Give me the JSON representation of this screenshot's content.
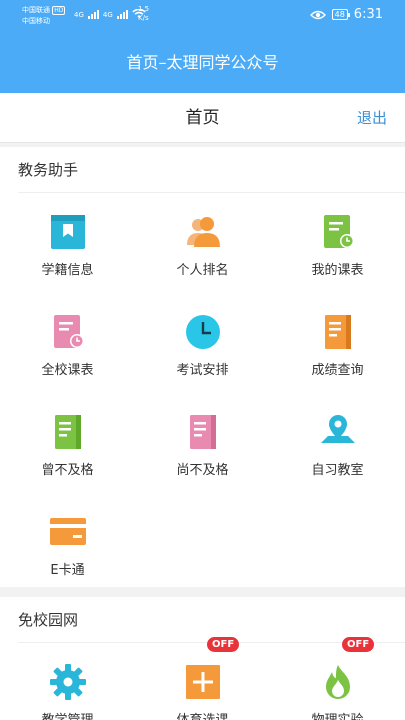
{
  "status_bar": {
    "carrier1": "中国联通",
    "carrier1_badge": "HD",
    "carrier2": "中国移动",
    "net1": "4G",
    "net2": "4G",
    "speed_value": "1.5",
    "speed_unit": "K/s",
    "battery": "48",
    "time": "6:31"
  },
  "app_bar": {
    "title": "首页–太理同学公众号"
  },
  "nav": {
    "title": "首页",
    "logout": "退出"
  },
  "sections": {
    "academic": {
      "title": "教务助手",
      "items": [
        {
          "label": "学籍信息",
          "icon": "bookmark-book-icon",
          "color": "#29b6d8"
        },
        {
          "label": "个人排名",
          "icon": "users-icon",
          "color": "#f59a3a"
        },
        {
          "label": "我的课表",
          "icon": "schedule-icon",
          "color": "#7cc243"
        },
        {
          "label": "全校课表",
          "icon": "school-schedule-icon",
          "color": "#e98bb1"
        },
        {
          "label": "考试安排",
          "icon": "clock-icon",
          "color": "#29c6e8"
        },
        {
          "label": "成绩查询",
          "icon": "grade-book-icon",
          "color": "#f59a3a"
        },
        {
          "label": "曾不及格",
          "icon": "book-icon",
          "color": "#7cc243"
        },
        {
          "label": "尚不及格",
          "icon": "book-icon",
          "color": "#e98bb1"
        },
        {
          "label": "自习教室",
          "icon": "map-pin-icon",
          "color": "#29b6d8"
        },
        {
          "label": "E卡通",
          "icon": "card-icon",
          "color": "#f59a3a"
        }
      ]
    },
    "offcampus": {
      "title": "免校园网",
      "items": [
        {
          "label": "教学管理",
          "icon": "gear-icon",
          "color": "#29b6d8",
          "badge": ""
        },
        {
          "label": "体育选课",
          "icon": "plus-box-icon",
          "color": "#f59a3a",
          "badge": "OFF"
        },
        {
          "label": "物理实验",
          "icon": "flame-icon",
          "color": "#7cc243",
          "badge": "OFF"
        }
      ]
    }
  }
}
